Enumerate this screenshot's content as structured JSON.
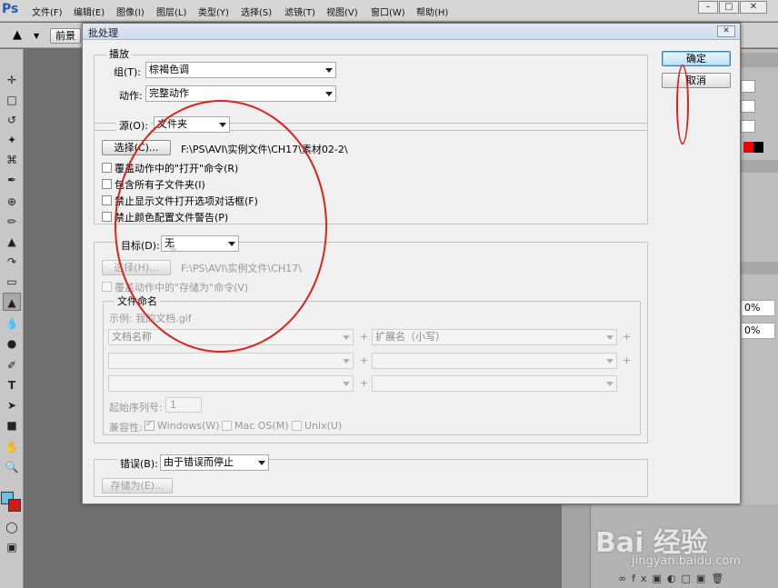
{
  "app": {
    "logo": "Ps"
  },
  "menu": [
    "文件(F)",
    "编辑(E)",
    "图像(I)",
    "图层(L)",
    "类型(Y)",
    "选择(S)",
    "滤镜(T)",
    "视图(V)",
    "窗口(W)",
    "帮助(H)"
  ],
  "window_buttons": {
    "minimize": "–",
    "restore": "□",
    "close": "✕"
  },
  "options_bar": {
    "foreground_label": "前景"
  },
  "dialog": {
    "title": "批处理",
    "close": "✕",
    "ok": "确定",
    "cancel": "取消",
    "play": {
      "legend": "播放",
      "group_label": "组(T):",
      "group_value": "棕褐色调",
      "action_label": "动作:",
      "action_value": "完整动作"
    },
    "source": {
      "label": "源(O):",
      "value": "文件夹",
      "choose_btn": "选择(C)...",
      "path": "F:\\PS\\AVI\\实例文件\\CH17\\素材02-2\\",
      "checkboxes": [
        "覆盖动作中的\"打开\"命令(R)",
        "包含所有子文件夹(I)",
        "禁止显示文件打开选项对话框(F)",
        "禁止颜色配置文件警告(P)"
      ]
    },
    "target": {
      "label": "目标(D):",
      "value": "无",
      "choose_btn": "选择(H)...",
      "path": "F:\\PS\\AVI\\实例文件\\CH17\\",
      "override_checkbox": "覆盖动作中的\"存储为\"命令(V)",
      "naming": {
        "legend": "文件命名",
        "example": "示例: 我的文档.gif",
        "row1_left": "文档名称",
        "row1_right": "扩展名（小写）",
        "plus": "+",
        "serial_label": "起始序列号:",
        "serial_value": "1",
        "compat_label": "兼容性:",
        "compat_windows": "Windows(W)",
        "compat_mac": "Mac OS(M)",
        "compat_unix": "Unix(U)"
      }
    },
    "errors": {
      "label": "错误(B):",
      "value": "由于错误而停止",
      "save_btn": "存储为(E)..."
    }
  },
  "right_panel": {
    "pct1": "0%",
    "pct2": "0%"
  },
  "watermark": {
    "brand": "Bai 经验",
    "url": "jingyan.baidu.com"
  }
}
